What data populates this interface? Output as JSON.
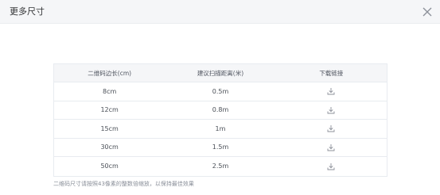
{
  "dialog": {
    "title": "更多尺寸",
    "close_icon": "close-icon"
  },
  "table": {
    "headers": [
      "二维码边长(cm)",
      "建议扫描距离(米)",
      "下载链接"
    ],
    "rows": [
      {
        "size": "8cm",
        "distance": "0.5m",
        "download_icon": "download-icon"
      },
      {
        "size": "12cm",
        "distance": "0.8m",
        "download_icon": "download-icon"
      },
      {
        "size": "15cm",
        "distance": "1m",
        "download_icon": "download-icon"
      },
      {
        "size": "30cm",
        "distance": "1.5m",
        "download_icon": "download-icon"
      },
      {
        "size": "50cm",
        "distance": "2.5m",
        "download_icon": "download-icon"
      }
    ]
  },
  "note": "二维码尺寸请按照43像素的整数倍缩放，以保持最佳效果",
  "colors": {
    "header_bg": "#f5f6f8",
    "border": "#e8ebf0",
    "text": "#4a4f57",
    "icon": "#8c9099"
  }
}
